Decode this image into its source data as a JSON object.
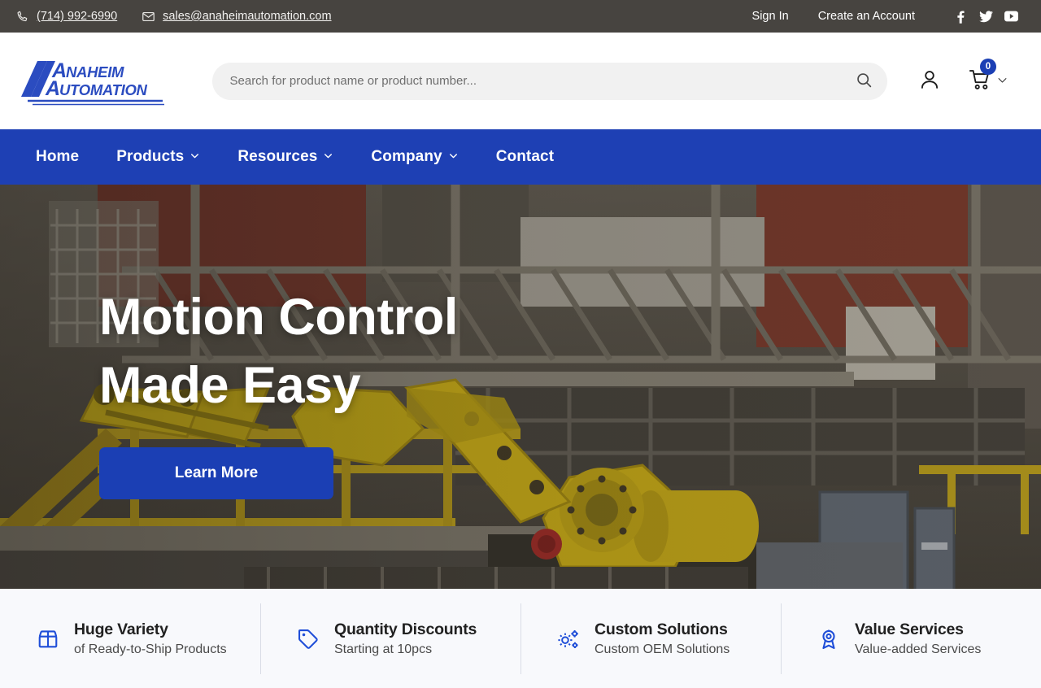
{
  "topbar": {
    "phone": "(714) 992-6990",
    "phone_icon": "phone-icon",
    "email": "sales@anaheimautomation.com",
    "email_icon": "envelope-icon",
    "sign_in": "Sign In",
    "create_account": "Create an Account",
    "socials": [
      {
        "name": "facebook-icon",
        "label": "Facebook"
      },
      {
        "name": "twitter-icon",
        "label": "Twitter"
      },
      {
        "name": "youtube-icon",
        "label": "YouTube"
      }
    ]
  },
  "header": {
    "logo_line1": "ANAHEIM",
    "logo_line2": "AUTOMATION",
    "logo_alt": "Anaheim Automation",
    "search_placeholder": "Search for product name or product number...",
    "search_value": "",
    "search_icon": "search-icon",
    "account_icon": "user-icon",
    "cart_icon": "shopping-cart-icon",
    "cart_count": "0",
    "cart_chevron": "chevron-down-icon"
  },
  "nav": {
    "items": [
      {
        "label": "Home",
        "has_dropdown": false
      },
      {
        "label": "Products",
        "has_dropdown": true
      },
      {
        "label": "Resources",
        "has_dropdown": true
      },
      {
        "label": "Company",
        "has_dropdown": true
      },
      {
        "label": "Contact",
        "has_dropdown": false
      }
    ]
  },
  "hero": {
    "title_line1": "Motion Control",
    "title_line2": "Made Easy",
    "cta_label": "Learn More",
    "image_description": "Yellow industrial robotic arm in a factory with steel trusses and yellow safety railings"
  },
  "features": [
    {
      "icon": "box-icon",
      "title": "Huge Variety",
      "subtitle": "of Ready-to-Ship Products"
    },
    {
      "icon": "tag-icon",
      "title": "Quantity Discounts",
      "subtitle": "Starting at 10pcs"
    },
    {
      "icon": "gears-icon",
      "title": "Custom Solutions",
      "subtitle": "Custom OEM Solutions"
    },
    {
      "icon": "award-icon",
      "title": "Value Services",
      "subtitle": "Value-added Services"
    }
  ],
  "colors": {
    "topbar_bg": "#474440",
    "nav_blue": "#1e40b4",
    "brand_blue": "#1b3fb4",
    "feature_bg": "#f8f9fc",
    "logo_blue": "#2b4cc0"
  }
}
